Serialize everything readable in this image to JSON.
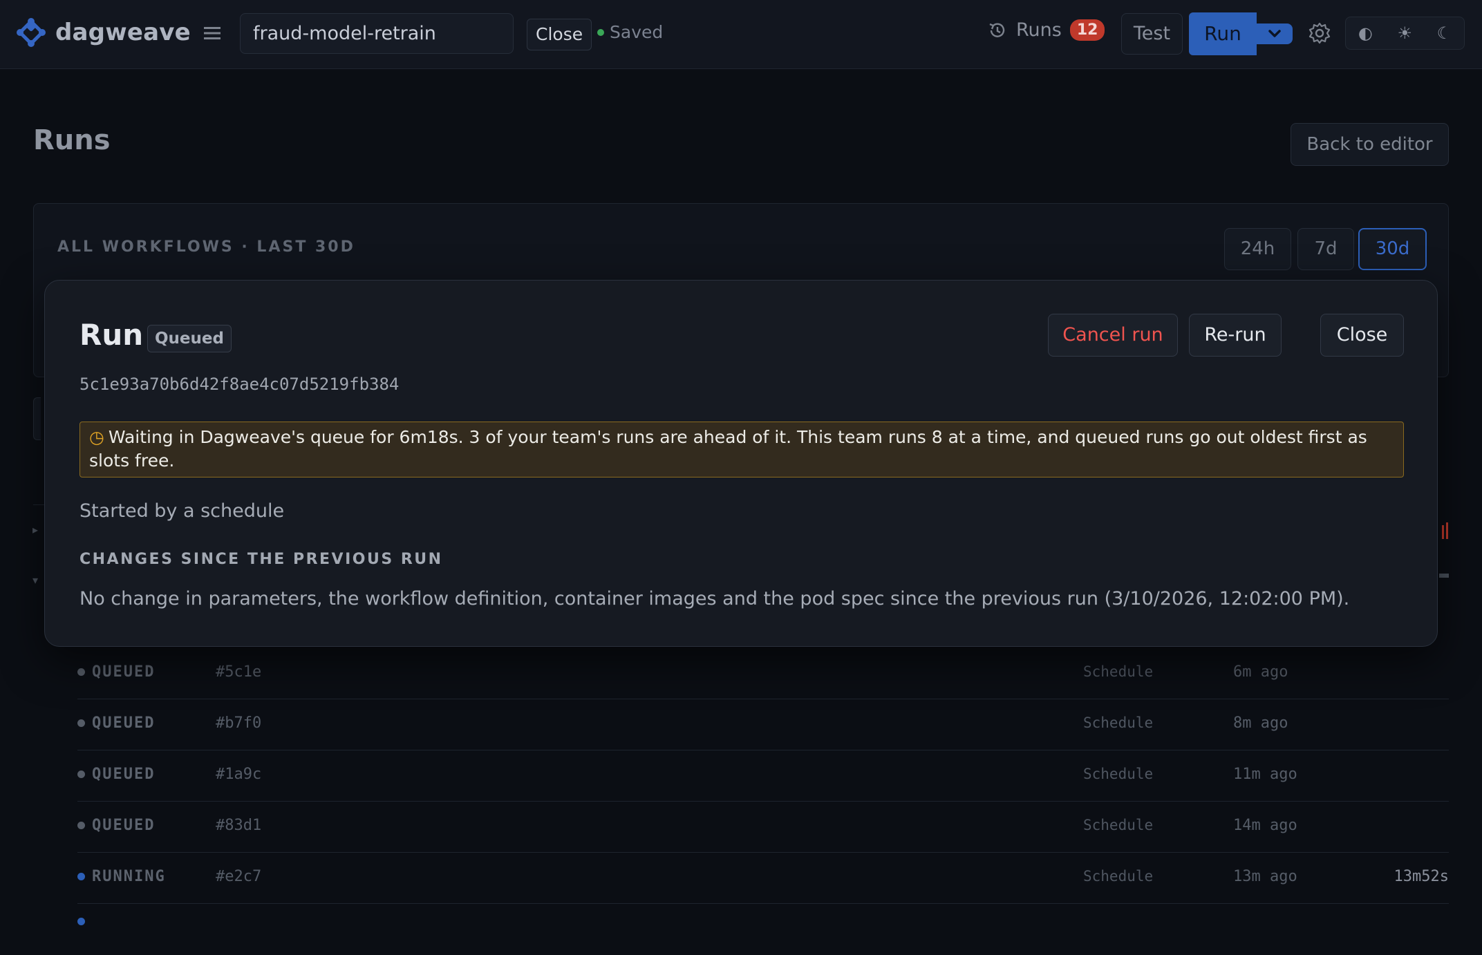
{
  "topbar": {
    "brand": "dagweave",
    "workflow_name": "fraud-model-retrain",
    "close_label": "Close",
    "saved_label": "Saved",
    "runs_label": "Runs",
    "runs_count": "12",
    "test_label": "Test",
    "run_label": "Run",
    "theme_icons": [
      "◐",
      "☀",
      "☾"
    ]
  },
  "page": {
    "title": "Runs",
    "back_label": "Back to editor",
    "panel_label": "ALL WORKFLOWS · LAST 30D",
    "ranges": [
      "24h",
      "7d",
      "30d"
    ],
    "active_range": "30d"
  },
  "modal": {
    "title": "Run",
    "status_badge": "Queued",
    "cancel_label": "Cancel run",
    "rerun_label": "Re-run",
    "close_label": "Close",
    "hash": "5c1e93a70b6d42f8ae4c07d5219fb384",
    "notice_icon": "◷",
    "notice": "Waiting in Dagweave's queue for 6m18s. 3 of your team's runs are ahead of it. This team runs 8 at a time, and queued runs go out oldest first as slots free.",
    "started_by": "Started by a schedule",
    "changes_heading": "CHANGES SINCE THE PREVIOUS RUN",
    "changes_text": "No change in parameters, the workflow definition, container images and the pod spec since the previous run (3/10/2026, 12:02:00 PM)."
  },
  "runs": [
    {
      "status": "QUEUED",
      "id": "#5c1e",
      "trigger": "Schedule",
      "ago": "6m ago",
      "duration": ""
    },
    {
      "status": "QUEUED",
      "id": "#b7f0",
      "trigger": "Schedule",
      "ago": "8m ago",
      "duration": ""
    },
    {
      "status": "QUEUED",
      "id": "#1a9c",
      "trigger": "Schedule",
      "ago": "11m ago",
      "duration": ""
    },
    {
      "status": "QUEUED",
      "id": "#83d1",
      "trigger": "Schedule",
      "ago": "14m ago",
      "duration": ""
    },
    {
      "status": "RUNNING",
      "id": "#e2c7",
      "trigger": "Schedule",
      "ago": "13m ago",
      "duration": "13m52s"
    }
  ],
  "colors": {
    "accent": "#2c5fb8",
    "danger": "#f0544f",
    "warning_border": "#8a6a1f",
    "saved": "#3aa757"
  }
}
